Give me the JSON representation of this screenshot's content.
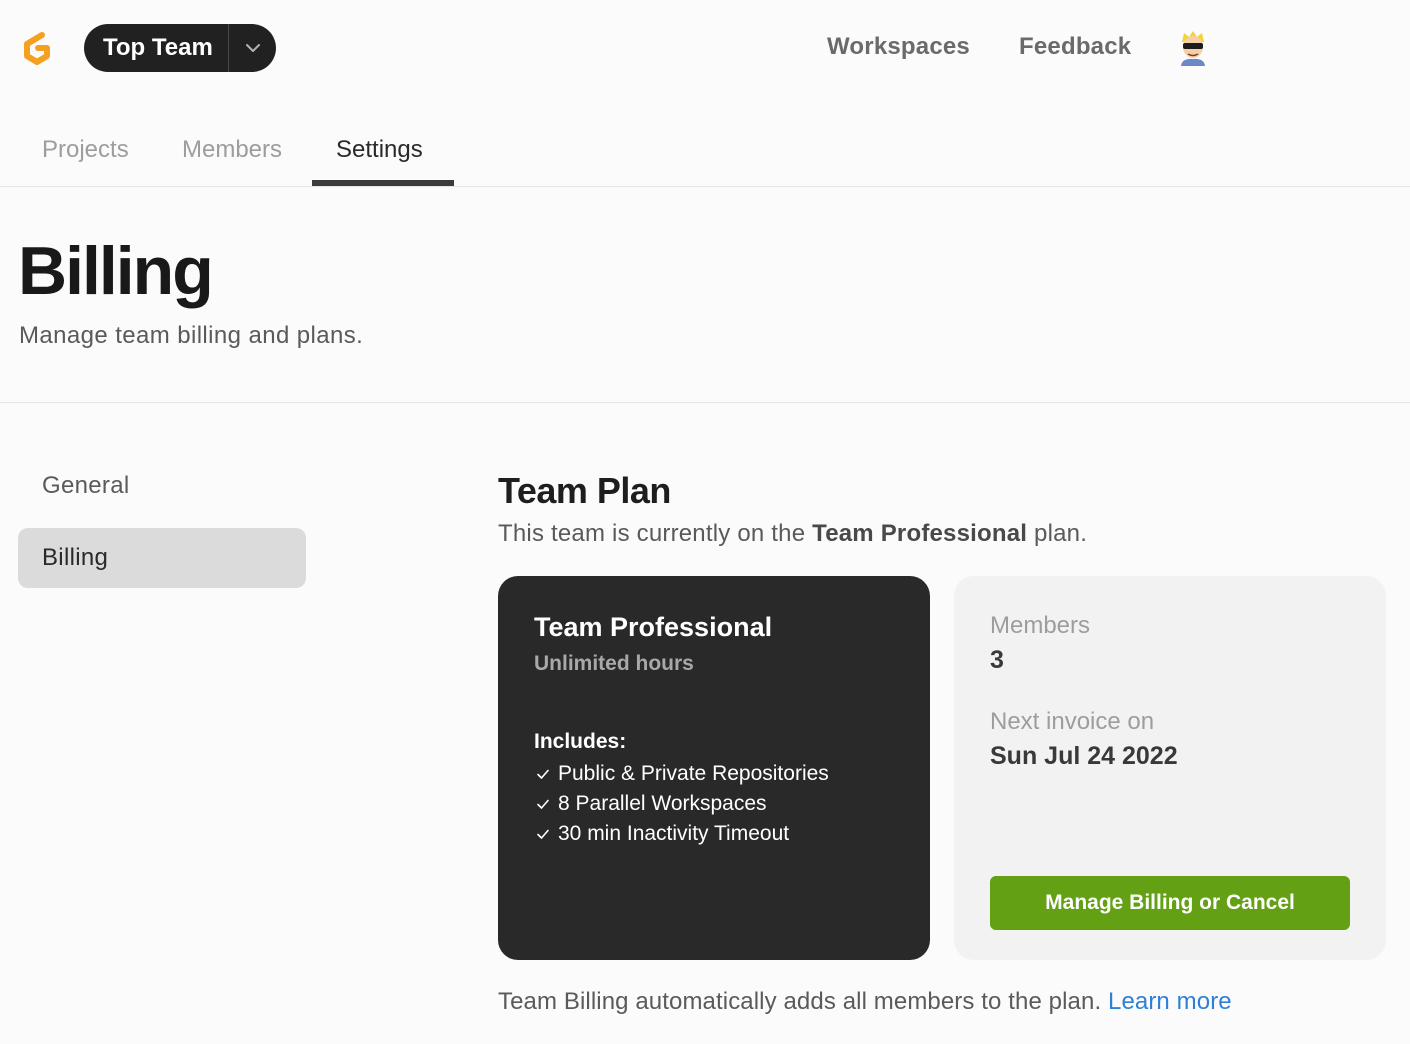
{
  "header": {
    "logo_icon": "gitpod-logo-icon",
    "team_name": "Top Team",
    "team_switcher_icon": "chevron-down-icon",
    "nav": [
      "Workspaces",
      "Feedback"
    ],
    "avatar_icon": "user-avatar-icon"
  },
  "tabs": [
    {
      "label": "Projects",
      "active": false
    },
    {
      "label": "Members",
      "active": false
    },
    {
      "label": "Settings",
      "active": true
    }
  ],
  "page": {
    "title": "Billing",
    "subtitle": "Manage team billing and plans."
  },
  "sidebar": {
    "items": [
      {
        "label": "General",
        "active": false
      },
      {
        "label": "Billing",
        "active": true
      }
    ]
  },
  "plan_section": {
    "title": "Team Plan",
    "desc_prefix": "This team is currently on the ",
    "desc_plan": "Team Professional",
    "desc_suffix": " plan."
  },
  "plan_card": {
    "name": "Team Professional",
    "subtitle": "Unlimited hours",
    "includes_label": "Includes:",
    "features": [
      "Public & Private Repositories",
      "8 Parallel Workspaces",
      "30 min Inactivity Timeout"
    ],
    "feature_icon": "check-icon"
  },
  "info_card": {
    "members_label": "Members",
    "members_value": "3",
    "invoice_label": "Next invoice on",
    "invoice_value": "Sun Jul 24 2022",
    "button_label": "Manage Billing or Cancel"
  },
  "footnote": {
    "text": "Team Billing automatically adds all members to the plan. ",
    "link": "Learn more"
  },
  "colors": {
    "accent_green": "#63a013",
    "link_blue": "#2e7fd6",
    "dark_card": "#2a2929",
    "logo_orange": "#f4a021"
  }
}
